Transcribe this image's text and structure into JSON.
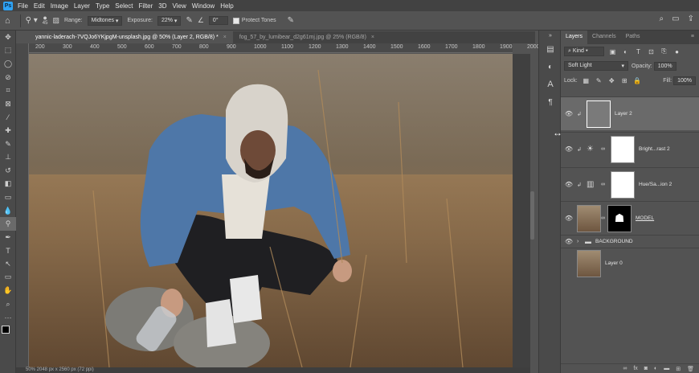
{
  "menubar": {
    "logo": "Ps",
    "items": [
      "File",
      "Edit",
      "Image",
      "Layer",
      "Type",
      "Select",
      "Filter",
      "3D",
      "View",
      "Window",
      "Help"
    ]
  },
  "options": {
    "brush_size": "45",
    "range_label": "Range:",
    "range_value": "Midtones",
    "exposure_label": "Exposure:",
    "exposure_value": "22%",
    "angle_value": "0°",
    "protect_tones_label": "Protect Tones"
  },
  "tabs": [
    {
      "label": "yannic-laderach-7VQJo6YKjpgM-unsplash.jpg @ 50% (Layer 2, RGB/8) *",
      "active": true
    },
    {
      "label": "fog_57_by_lumibear_d2g61mj.jpg @ 25% (RGB/8)",
      "active": false
    }
  ],
  "ruler_top_labels": [
    "200",
    "300",
    "400",
    "500",
    "600",
    "700",
    "800",
    "900",
    "1000",
    "1100",
    "1200",
    "1300",
    "1400",
    "1500",
    "1600",
    "1700",
    "1800",
    "1900",
    "2000"
  ],
  "status": "50%       2048 px x 2560 px (72 ppi)",
  "layers_panel": {
    "tabs": [
      "Layers",
      "Channels",
      "Paths"
    ],
    "kind_label": "Kind",
    "blend_mode": "Soft Light",
    "opacity_label": "Opacity:",
    "opacity_value": "100%",
    "lock_label": "Lock:",
    "fill_label": "Fill:",
    "fill_value": "100%",
    "layers": [
      {
        "name": "Layer 2",
        "selected": true
      },
      {
        "name": "Bright...rast 2"
      },
      {
        "name": "Hue/Sa...ion 2"
      },
      {
        "name": "MODEL"
      },
      {
        "name": "BACKGROUND"
      },
      {
        "name": "Layer 0"
      }
    ]
  },
  "colors": {
    "accent": "#2fa3f5",
    "panel_bg": "#535353",
    "dark_bg": "#424242",
    "selected_layer": "#6a6a6a"
  }
}
